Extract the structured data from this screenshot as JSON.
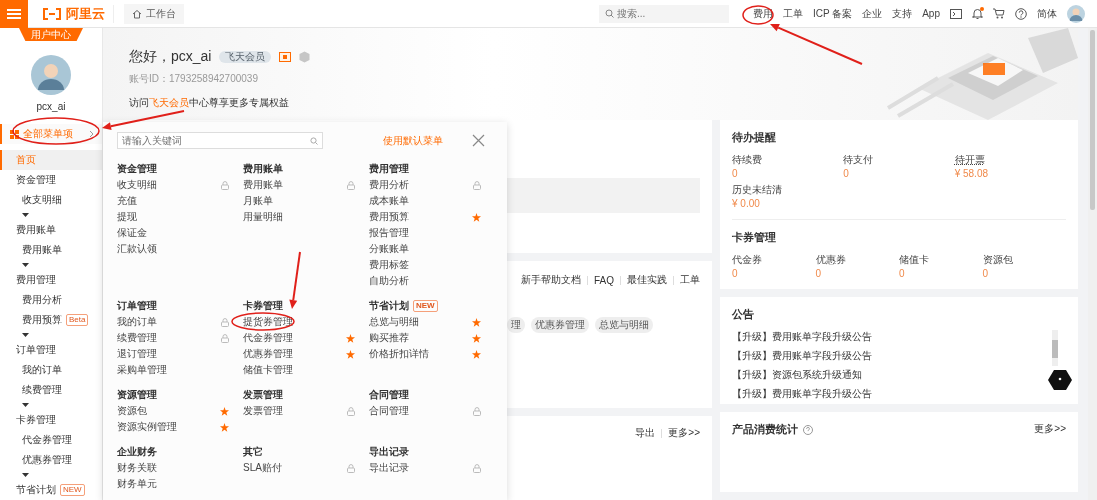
{
  "topbar": {
    "logo": "阿里云",
    "workbench": "工作台",
    "search": {
      "placeholder": "搜索..."
    },
    "links": [
      {
        "label": "费用"
      },
      {
        "label": "工单"
      },
      {
        "label": "ICP 备案"
      },
      {
        "label": "企业"
      },
      {
        "label": "支持"
      },
      {
        "label": "App"
      }
    ],
    "notification_dot": true,
    "language": "简体"
  },
  "sidebar": {
    "tab": "用户中心",
    "username": "pcx_ai",
    "all_menu": "全部菜单项",
    "nav": [
      {
        "label": "首页",
        "selected": true
      },
      {
        "label": "资金管理",
        "selected": false,
        "children": [
          {
            "label": "收支明细",
            "selected": false
          }
        ]
      },
      {
        "label": "费用账单",
        "selected": false,
        "children": [
          {
            "label": "费用账单",
            "selected": false
          }
        ]
      },
      {
        "label": "费用管理",
        "selected": false,
        "children": [
          {
            "label": "费用分析",
            "selected": false
          },
          {
            "label": "费用预算",
            "selected": false,
            "badge": "Beta"
          }
        ]
      },
      {
        "label": "订单管理",
        "selected": false,
        "children": [
          {
            "label": "我的订单",
            "selected": false
          },
          {
            "label": "续费管理",
            "selected": false
          }
        ]
      },
      {
        "label": "卡券管理",
        "selected": false,
        "children": [
          {
            "label": "代金券管理",
            "selected": false
          },
          {
            "label": "优惠券管理",
            "selected": false
          }
        ]
      },
      {
        "label": "节省计划",
        "selected": false,
        "badge": "NEW"
      }
    ]
  },
  "header": {
    "greeting": "您好，pcx_ai",
    "member_badge": "飞天会员",
    "account_id": "账号ID：1793258942700039",
    "promo": {
      "before": "访问",
      "link": "飞天会员",
      "after": "中心尊享更多专属权益"
    }
  },
  "menu_panel": {
    "search": {
      "placeholder": "请输入关键词"
    },
    "reset": "使用默认菜单",
    "rows": [
      {
        "sections": [
          {
            "title": "资金管理",
            "items": [
              {
                "label": "收支明细",
                "kind": "lock"
              },
              {
                "label": "充值",
                "kind": "plain"
              },
              {
                "label": "提现",
                "kind": "plain"
              },
              {
                "label": "保证金",
                "kind": "plain"
              },
              {
                "label": "汇款认领",
                "kind": "plain"
              }
            ]
          },
          {
            "title": "费用账单",
            "items": [
              {
                "label": "费用账单",
                "kind": "lock"
              },
              {
                "label": "月账单",
                "kind": "plain"
              },
              {
                "label": "用量明细",
                "kind": "plain"
              }
            ]
          },
          {
            "title": "费用管理",
            "items": [
              {
                "label": "费用分析",
                "kind": "lock"
              },
              {
                "label": "成本账单",
                "kind": "plain"
              },
              {
                "label": "费用预算",
                "kind": "star"
              },
              {
                "label": "报告管理",
                "kind": "plain"
              },
              {
                "label": "分账账单",
                "kind": "plain"
              },
              {
                "label": "费用标签",
                "kind": "plain"
              },
              {
                "label": "自助分析",
                "kind": "plain"
              }
            ]
          }
        ]
      },
      {
        "sections": [
          {
            "title": "订单管理",
            "items": [
              {
                "label": "我的订单",
                "kind": "lock"
              },
              {
                "label": "续费管理",
                "kind": "lock"
              },
              {
                "label": "退订管理",
                "kind": "plain"
              },
              {
                "label": "采购单管理",
                "kind": "plain"
              }
            ]
          },
          {
            "title": "卡券管理",
            "items": [
              {
                "label": "提货券管理",
                "kind": "plain"
              },
              {
                "label": "代金券管理",
                "kind": "star"
              },
              {
                "label": "优惠券管理",
                "kind": "star"
              },
              {
                "label": "储值卡管理",
                "kind": "plain"
              }
            ]
          },
          {
            "title": "节省计划",
            "badge": "NEW",
            "items": [
              {
                "label": "总览与明细",
                "kind": "star"
              },
              {
                "label": "购买推荐",
                "kind": "star"
              },
              {
                "label": "价格折扣详情",
                "kind": "star"
              }
            ]
          }
        ]
      },
      {
        "sections": [
          {
            "title": "资源管理",
            "items": [
              {
                "label": "资源包",
                "kind": "star"
              },
              {
                "label": "资源实例管理",
                "kind": "star"
              }
            ]
          },
          {
            "title": "发票管理",
            "items": [
              {
                "label": "发票管理",
                "kind": "lock"
              }
            ]
          },
          {
            "title": "合同管理",
            "items": [
              {
                "label": "合同管理",
                "kind": "lock"
              }
            ]
          }
        ]
      },
      {
        "sections": [
          {
            "title": "企业财务",
            "items": [
              {
                "label": "财务关联",
                "kind": "plain"
              },
              {
                "label": "财务单元",
                "kind": "plain"
              }
            ]
          },
          {
            "title": "其它",
            "items": [
              {
                "label": "SLA赔付",
                "kind": "lock"
              }
            ]
          },
          {
            "title": "导出记录",
            "items": [
              {
                "label": "导出记录",
                "kind": "lock"
              }
            ]
          }
        ]
      }
    ]
  },
  "help_card": {
    "links": [
      "新手帮助文档",
      "FAQ",
      "最佳实践",
      "工单"
    ],
    "chips": [
      "理",
      "优惠券管理",
      "总览与明细"
    ]
  },
  "orders_card": {
    "links": [
      "导出",
      "更多>>"
    ]
  },
  "todo": {
    "title": "待办提醒",
    "items": [
      {
        "label": "待续费",
        "value": "0",
        "dotted": false
      },
      {
        "label": "待支付",
        "value": "0",
        "dotted": false
      },
      {
        "label": "待开票",
        "value": "¥ 58.08",
        "dotted": true
      },
      {
        "label": "历史未结清",
        "value": "¥ 0.00",
        "dotted": false
      }
    ]
  },
  "coupons": {
    "title": "卡券管理",
    "items": [
      {
        "label": "代金券",
        "value": "0"
      },
      {
        "label": "优惠券",
        "value": "0"
      },
      {
        "label": "储值卡",
        "value": "0"
      },
      {
        "label": "资源包",
        "value": "0"
      }
    ]
  },
  "notices": {
    "title": "公告",
    "items": [
      "【升级】费用账单字段升级公告",
      "【升级】费用账单字段升级公告",
      "【升级】资源包系统升级通知",
      "【升级】费用账单字段升级公告"
    ]
  },
  "consumption": {
    "title": "产品消费统计",
    "more": "更多>>"
  }
}
